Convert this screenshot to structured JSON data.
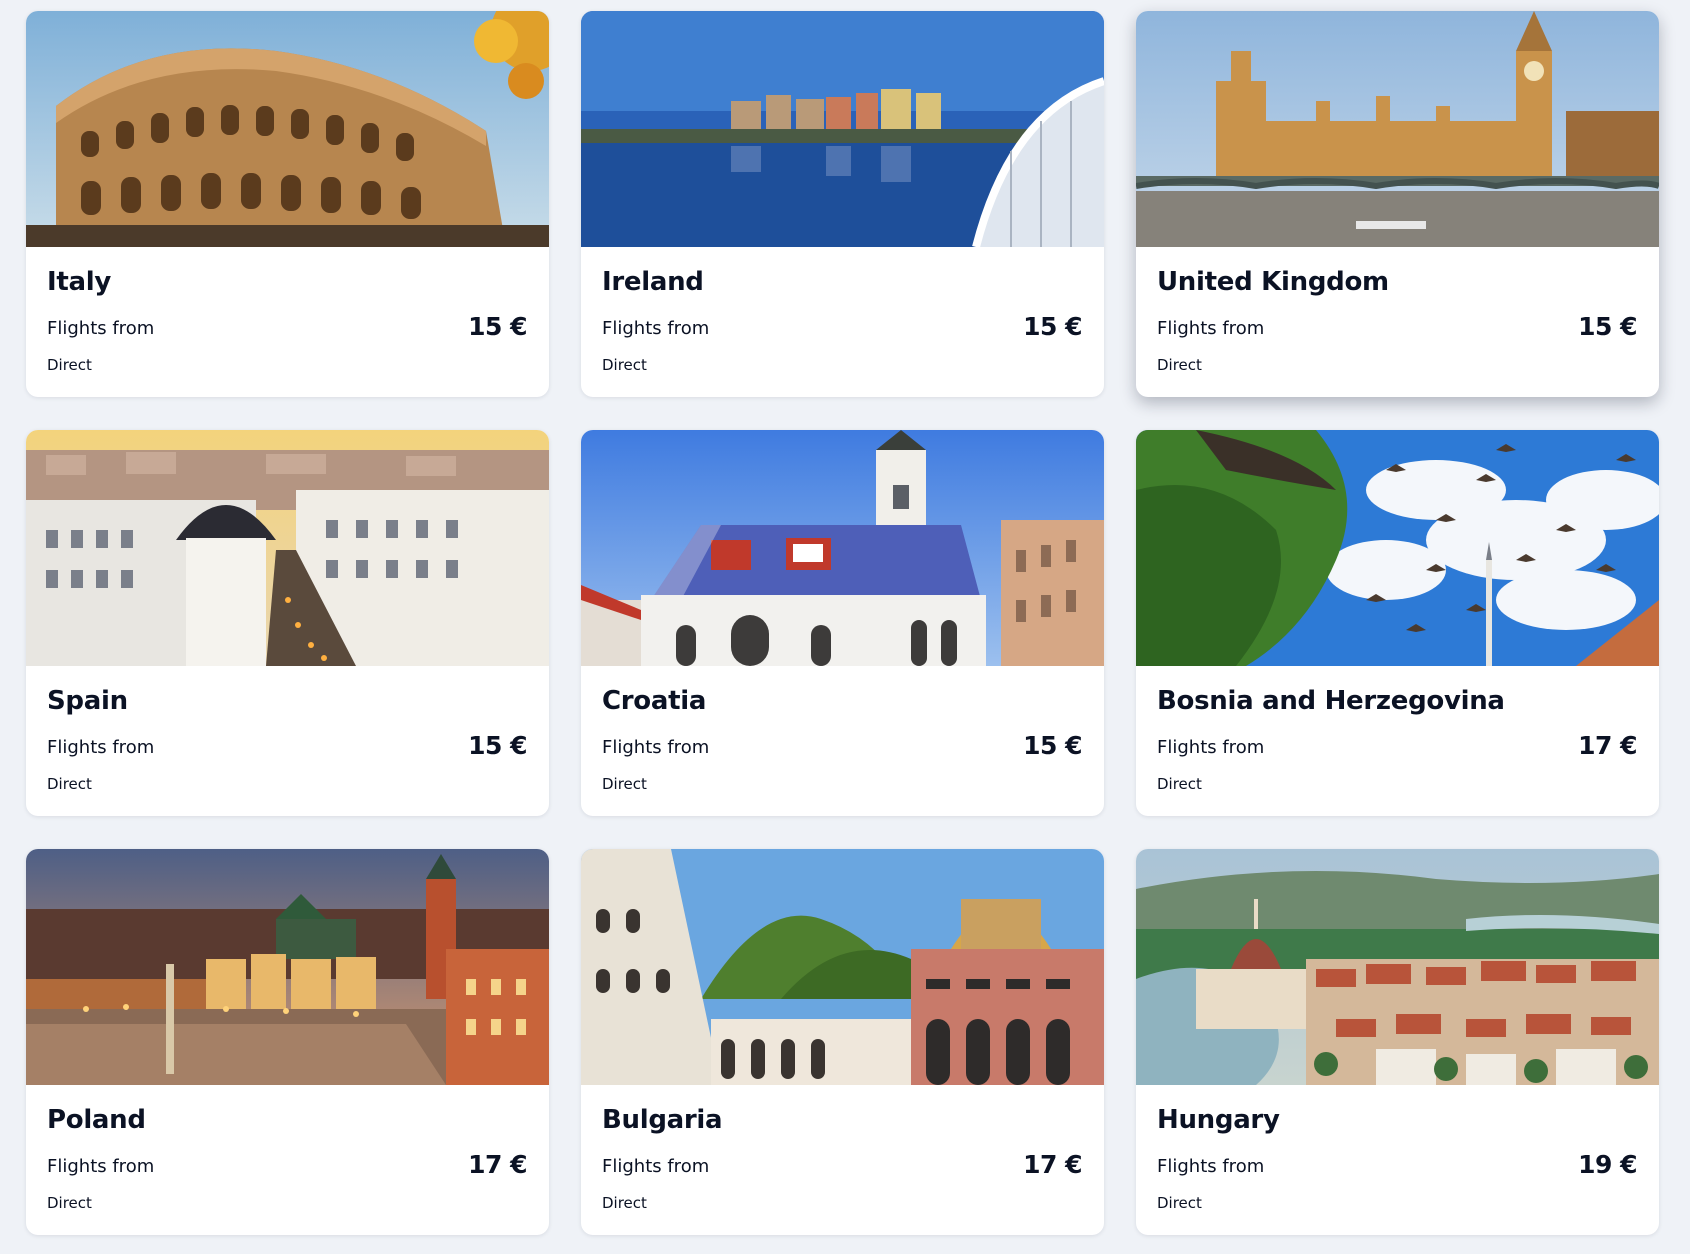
{
  "destinations": [
    {
      "country": "Italy",
      "label": "Flights from",
      "price": "15 €",
      "stops": "Direct",
      "image": "colosseum-photo"
    },
    {
      "country": "Ireland",
      "label": "Flights from",
      "price": "15 €",
      "stops": "Direct",
      "image": "river-bridge-photo"
    },
    {
      "country": "United Kingdom",
      "label": "Flights from",
      "price": "15 €",
      "stops": "Direct",
      "image": "parliament-big-ben-photo"
    },
    {
      "country": "Spain",
      "label": "Flights from",
      "price": "15 €",
      "stops": "Direct",
      "image": "city-avenue-photo"
    },
    {
      "country": "Croatia",
      "label": "Flights from",
      "price": "15 €",
      "stops": "Direct",
      "image": "tiled-roof-church-photo"
    },
    {
      "country": "Bosnia and Herzegovina",
      "label": "Flights from",
      "price": "17 €",
      "stops": "Direct",
      "image": "pigeons-sky-photo"
    },
    {
      "country": "Poland",
      "label": "Flights from",
      "price": "17 €",
      "stops": "Direct",
      "image": "old-town-square-photo"
    },
    {
      "country": "Bulgaria",
      "label": "Flights from",
      "price": "17 €",
      "stops": "Direct",
      "image": "monastery-courtyard-photo"
    },
    {
      "country": "Hungary",
      "label": "Flights from",
      "price": "19 €",
      "stops": "Direct",
      "image": "danube-parliament-photo"
    }
  ],
  "colors": {
    "page_background": "#eff2f7",
    "card_background": "#ffffff",
    "text": "#0b1224"
  }
}
